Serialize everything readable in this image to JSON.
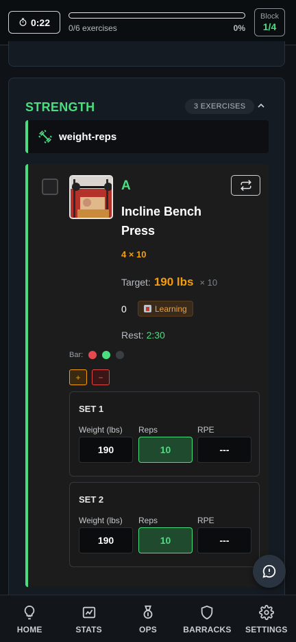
{
  "header": {
    "timer": "0:22",
    "progress_text": "0/6 exercises",
    "progress_pct": "0%",
    "progress_value": 0,
    "block_label": "Block",
    "block_value": "1/4"
  },
  "section": {
    "title": "STRENGTH",
    "count": "3 EXERCISES",
    "group_label": "weight-reps"
  },
  "exercise": {
    "letter": "A",
    "name": "Incline Bench Press",
    "sets_reps": "4 × 10",
    "target_label": "Target:",
    "target_weight": "190 lbs",
    "target_reps": "× 10",
    "streak": "0",
    "status_badge": "Learning",
    "rest_label": "Rest:",
    "rest_value": "2:30",
    "bar_label": "Bar:",
    "bar_colors": [
      "#e5484d",
      "#4ade80",
      "#3a3d42"
    ],
    "plus_label": "+",
    "minus_label": "−"
  },
  "sets": [
    {
      "title": "SET 1",
      "weight_label": "Weight (lbs)",
      "reps_label": "Reps",
      "rpe_label": "RPE",
      "weight": "190",
      "reps": "10",
      "rpe": "---"
    },
    {
      "title": "SET 2",
      "weight_label": "Weight (lbs)",
      "reps_label": "Reps",
      "rpe_label": "RPE",
      "weight": "190",
      "reps": "10",
      "rpe": "---"
    }
  ],
  "nav": [
    {
      "label": "HOME",
      "icon": "lightbulb-icon"
    },
    {
      "label": "STATS",
      "icon": "chart-icon"
    },
    {
      "label": "OPS",
      "icon": "medal-icon"
    },
    {
      "label": "BARRACKS",
      "icon": "shield-icon"
    },
    {
      "label": "SETTINGS",
      "icon": "gear-icon"
    }
  ],
  "colors": {
    "accent": "#4ade80",
    "warning": "#f59e0b",
    "danger": "#e04848"
  }
}
